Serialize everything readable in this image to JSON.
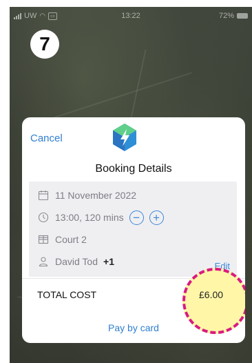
{
  "status_bar": {
    "carrier": "UW",
    "time": "13:22",
    "battery": "72%"
  },
  "step_number": "7",
  "dialog": {
    "cancel_label": "Cancel",
    "title": "Booking Details",
    "date": "11 November 2022",
    "time_duration": "13:00, 120 mins",
    "decrement_symbol": "−",
    "increment_symbol": "+",
    "court": "Court 2",
    "player_name": "David Tod",
    "extra_players": "+1",
    "edit_label": "Edit",
    "total_label": "TOTAL COST",
    "total_value": "£6.00",
    "pay_label": "Pay by card"
  },
  "colors": {
    "accent": "#2f7fd0",
    "highlight_fill": "#fff6a8",
    "highlight_border": "#d81b7f"
  },
  "icons": [
    "calendar-icon",
    "clock-icon",
    "grid-icon",
    "person-icon",
    "app-logo-icon"
  ]
}
